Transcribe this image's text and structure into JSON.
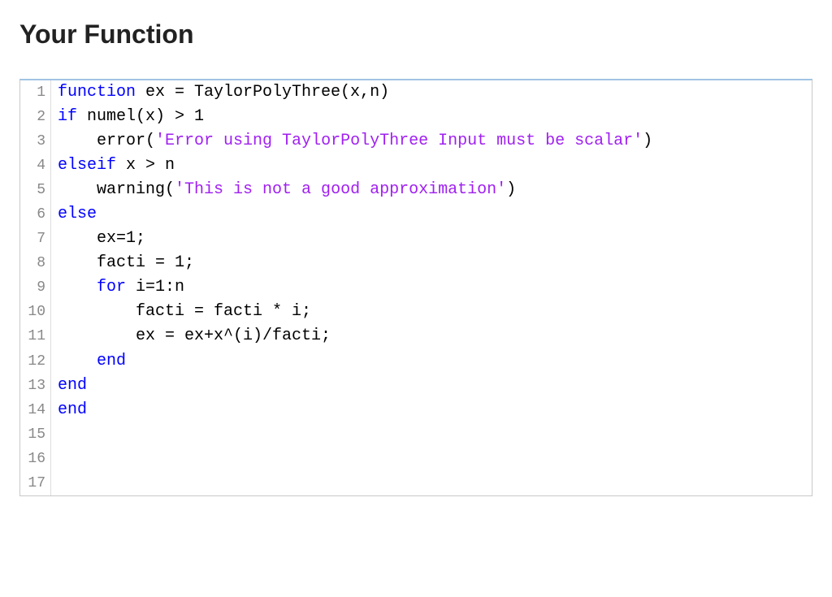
{
  "title": "Your Function",
  "code": {
    "lines": [
      {
        "num": "1",
        "tokens": [
          {
            "t": "function",
            "c": "kw"
          },
          {
            "t": " ex = TaylorPolyThree(x,n)",
            "c": ""
          }
        ]
      },
      {
        "num": "2",
        "tokens": [
          {
            "t": "if",
            "c": "kw"
          },
          {
            "t": " numel(x) > 1",
            "c": ""
          }
        ]
      },
      {
        "num": "3",
        "tokens": [
          {
            "t": "    error(",
            "c": ""
          },
          {
            "t": "'Error using TaylorPolyThree Input must be scalar'",
            "c": "str"
          },
          {
            "t": ")",
            "c": ""
          }
        ]
      },
      {
        "num": "4",
        "tokens": [
          {
            "t": "elseif",
            "c": "kw"
          },
          {
            "t": " x > n",
            "c": ""
          }
        ]
      },
      {
        "num": "5",
        "tokens": [
          {
            "t": "    warning(",
            "c": ""
          },
          {
            "t": "'This is not a good approximation'",
            "c": "str"
          },
          {
            "t": ")",
            "c": ""
          }
        ]
      },
      {
        "num": "6",
        "tokens": [
          {
            "t": "else",
            "c": "kw"
          }
        ]
      },
      {
        "num": "7",
        "tokens": [
          {
            "t": "    ex=1;",
            "c": ""
          }
        ]
      },
      {
        "num": "8",
        "tokens": [
          {
            "t": "    facti = 1;",
            "c": ""
          }
        ]
      },
      {
        "num": "9",
        "tokens": [
          {
            "t": "    ",
            "c": ""
          },
          {
            "t": "for",
            "c": "kw"
          },
          {
            "t": " i=1:n",
            "c": ""
          }
        ]
      },
      {
        "num": "10",
        "tokens": [
          {
            "t": "        facti = facti * i;",
            "c": ""
          }
        ]
      },
      {
        "num": "11",
        "tokens": [
          {
            "t": "        ex = ex+x^(i)/facti;",
            "c": ""
          }
        ]
      },
      {
        "num": "12",
        "tokens": [
          {
            "t": "    ",
            "c": ""
          },
          {
            "t": "end",
            "c": "kw"
          }
        ]
      },
      {
        "num": "13",
        "tokens": [
          {
            "t": "end",
            "c": "kw"
          }
        ]
      },
      {
        "num": "14",
        "tokens": [
          {
            "t": "end",
            "c": "kw"
          }
        ]
      },
      {
        "num": "15",
        "tokens": [
          {
            "t": " ",
            "c": ""
          }
        ]
      },
      {
        "num": "16",
        "tokens": [
          {
            "t": " ",
            "c": ""
          }
        ]
      },
      {
        "num": "17",
        "tokens": [
          {
            "t": " ",
            "c": ""
          }
        ]
      }
    ]
  }
}
